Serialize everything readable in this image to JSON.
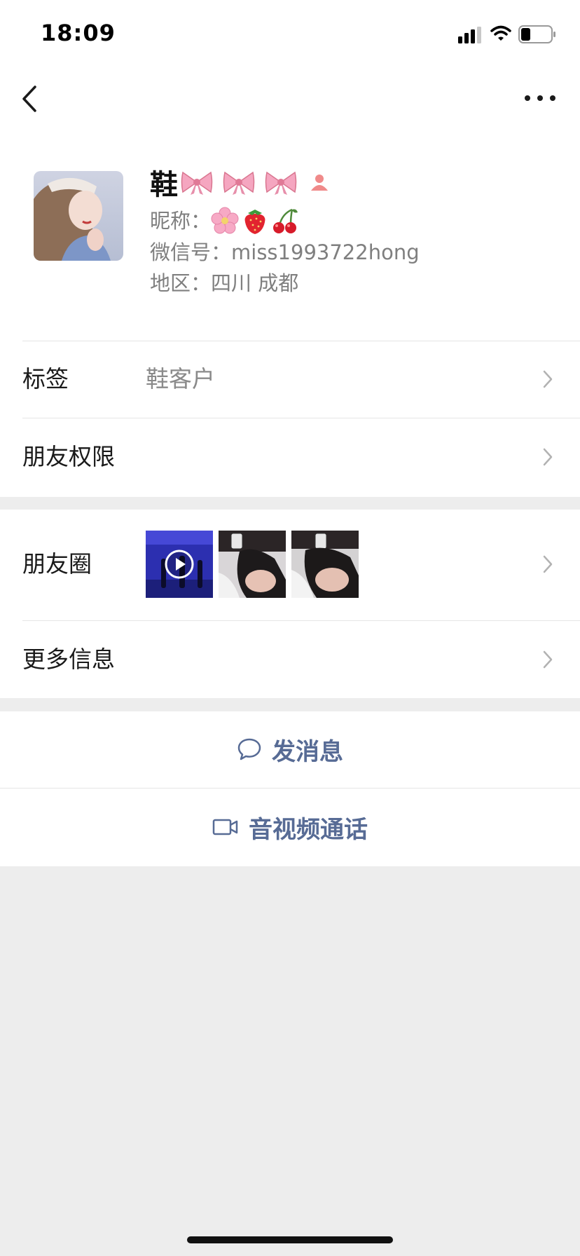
{
  "status_bar": {
    "time": "18:09",
    "icons": [
      "signal-icon",
      "wifi-icon",
      "battery-icon"
    ]
  },
  "nav": {
    "back_icon": "back-chevron-icon",
    "more_icon": "more-dots-icon"
  },
  "profile": {
    "name": "鞋",
    "name_decorations": [
      "bow-icon",
      "bow-icon",
      "bow-icon",
      "contact-badge-icon"
    ],
    "nickname_label": "昵称：",
    "nickname_emojis": [
      "cherry-blossom-icon",
      "strawberry-icon",
      "cherries-icon"
    ],
    "wechat_id_label": "微信号：",
    "wechat_id": "miss1993722hong",
    "region_label": "地区：",
    "region": "四川 成都"
  },
  "rows": {
    "tags_label": "标签",
    "tags_value": "鞋客户",
    "permissions_label": "朋友权限",
    "moments_label": "朋友圈",
    "more_info_label": "更多信息"
  },
  "actions": {
    "message_label": "发消息",
    "call_label": "音视频通话"
  },
  "colors": {
    "link_blue": "#576b95",
    "page_gray": "#ededed",
    "divider": "#e5e5e5",
    "secondary_text": "#7f7f7f"
  }
}
